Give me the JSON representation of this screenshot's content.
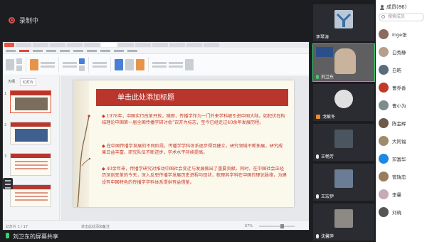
{
  "recording": {
    "label": "录制中"
  },
  "share": {
    "label": "刘卫东的屏幕共享"
  },
  "slide": {
    "title": "单击此处添加标题",
    "paragraphs": [
      "1978年，中国实行改革开放，随即，传播学作为一门外来学科被引进中国大陆。如犯伏在构结理论中国第一届全国传播学研讨会”召开为标志，至今已经走过40余年发展历程。",
      "在中国传播学发展的不同阶段，传播学学科体系逐步得到建立，研究领域不断拓展，研究成果日益丰富，研究队伍不断进步，学术水平持续提高。",
      "40余年来，传播学研究对推动中国社会变迁与发展做出了重要贡献。同时，在中国社会正经历深刻变革的今天，深入反思传播学发展历史进程与现状，梳理其学科在中国的理论脉络，为建设有中国特色的传播学学科体系提供有益借鉴。"
    ]
  },
  "statusbar": {
    "page": "幻灯片 1 / 17",
    "note": "单击此处添加备注",
    "zoom": "67%",
    "zoom_level": 0.67
  },
  "thumbpane": {
    "tab1": "大纲",
    "tab2": "幻灯片"
  },
  "videos": [
    {
      "name": "李琴涛",
      "mic": "none"
    },
    {
      "name": "刘卫东",
      "mic": "green"
    },
    {
      "name": "戈敏冬",
      "mic": "orange"
    },
    {
      "name": "王畅芳",
      "mic": "white"
    },
    {
      "name": "王宏伊",
      "mic": "white"
    },
    {
      "name": "沈馨萍",
      "mic": "white"
    }
  ],
  "members": {
    "title": "成员(86)",
    "search_placeholder": "搜索成员",
    "list": [
      {
        "name": "Inge张",
        "color": "#8a6b5c"
      },
      {
        "name": "白秀静",
        "color": "#b5a08e"
      },
      {
        "name": "白皓",
        "color": "#5a6b7c"
      },
      {
        "name": "曹乔香",
        "color": "#c0392b"
      },
      {
        "name": "曹小为",
        "color": "#7f8c8d"
      },
      {
        "name": "陈金辉",
        "color": "#6d5a4a"
      },
      {
        "name": "大阿福",
        "color": "#a08a6a"
      },
      {
        "name": "邓富华",
        "color": "#1e88e5"
      },
      {
        "name": "管瑞忠",
        "color": "#9a7b5a"
      },
      {
        "name": "李曼",
        "color": "#c8a9b5"
      },
      {
        "name": "刘晓",
        "color": "#555555"
      }
    ]
  },
  "colors": {
    "accent_red": "#b8362c",
    "speaker_green": "#3ccf6e",
    "background": "#1c1d21"
  }
}
